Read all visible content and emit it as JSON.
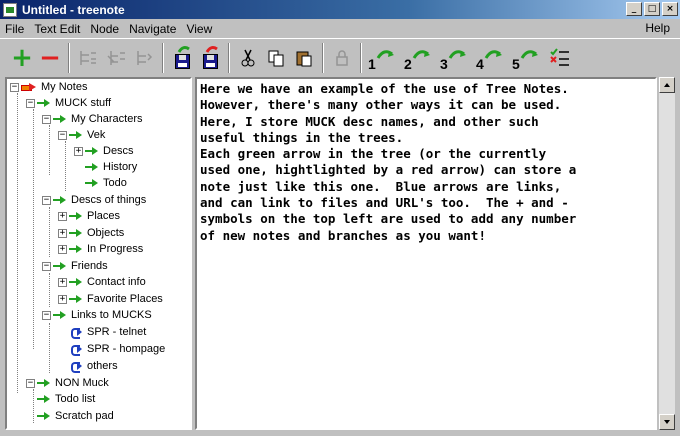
{
  "window": {
    "title": "Untitled - treenote"
  },
  "menu": {
    "items": [
      "File",
      "Text Edit",
      "Node",
      "Navigate",
      "View"
    ],
    "help": "Help"
  },
  "toolbar": {
    "numbered_bookmarks": [
      "1",
      "2",
      "3",
      "4",
      "5"
    ]
  },
  "tree": {
    "items": [
      {
        "label": "My Notes",
        "icon": "red-arrow-icon"
      },
      {
        "label": "MUCK stuff",
        "icon": "green-arrow-icon"
      },
      {
        "label": "My Characters",
        "icon": "green-arrow-icon"
      },
      {
        "label": "Vek",
        "icon": "green-arrow-icon"
      },
      {
        "label": "Descs",
        "icon": "green-arrow-icon"
      },
      {
        "label": "History",
        "icon": "green-arrow-icon"
      },
      {
        "label": "Todo",
        "icon": "green-arrow-icon"
      },
      {
        "label": "Descs of things",
        "icon": "green-arrow-icon"
      },
      {
        "label": "Places",
        "icon": "green-arrow-icon"
      },
      {
        "label": "Objects",
        "icon": "green-arrow-icon"
      },
      {
        "label": "In Progress",
        "icon": "green-arrow-icon"
      },
      {
        "label": "Friends",
        "icon": "green-arrow-icon"
      },
      {
        "label": "Contact info",
        "icon": "green-arrow-icon"
      },
      {
        "label": "Favorite Places",
        "icon": "green-arrow-icon"
      },
      {
        "label": "Links to MUCKS",
        "icon": "green-arrow-icon"
      },
      {
        "label": "SPR - telnet",
        "icon": "blue-link-arrow-icon"
      },
      {
        "label": "SPR - hompage",
        "icon": "blue-link-arrow-icon"
      },
      {
        "label": "others",
        "icon": "blue-link-arrow-icon"
      },
      {
        "label": "NON Muck",
        "icon": "green-arrow-icon"
      },
      {
        "label": "Todo list",
        "icon": "green-arrow-icon"
      },
      {
        "label": "Scratch pad",
        "icon": "green-arrow-icon"
      }
    ]
  },
  "note": {
    "text": "Here we have an example of the use of Tree Notes.\nHowever, there's many other ways it can be used.\nHere, I store MUCK desc names, and other such\nuseful things in the trees.\nEach green arrow in the tree (or the currently\nused one, hightlighted by a red arrow) can store a\nnote just like this one.  Blue arrows are links,\nand can link to files and URL's too.  The + and -\nsymbols on the top left are used to add any number\nof new notes and branches as you want!"
  },
  "colors": {
    "title_bar": "#0a246a",
    "node_arrow": "#22a022",
    "current_arrow": "#e02020",
    "link_arrow": "#1f3fbf"
  }
}
